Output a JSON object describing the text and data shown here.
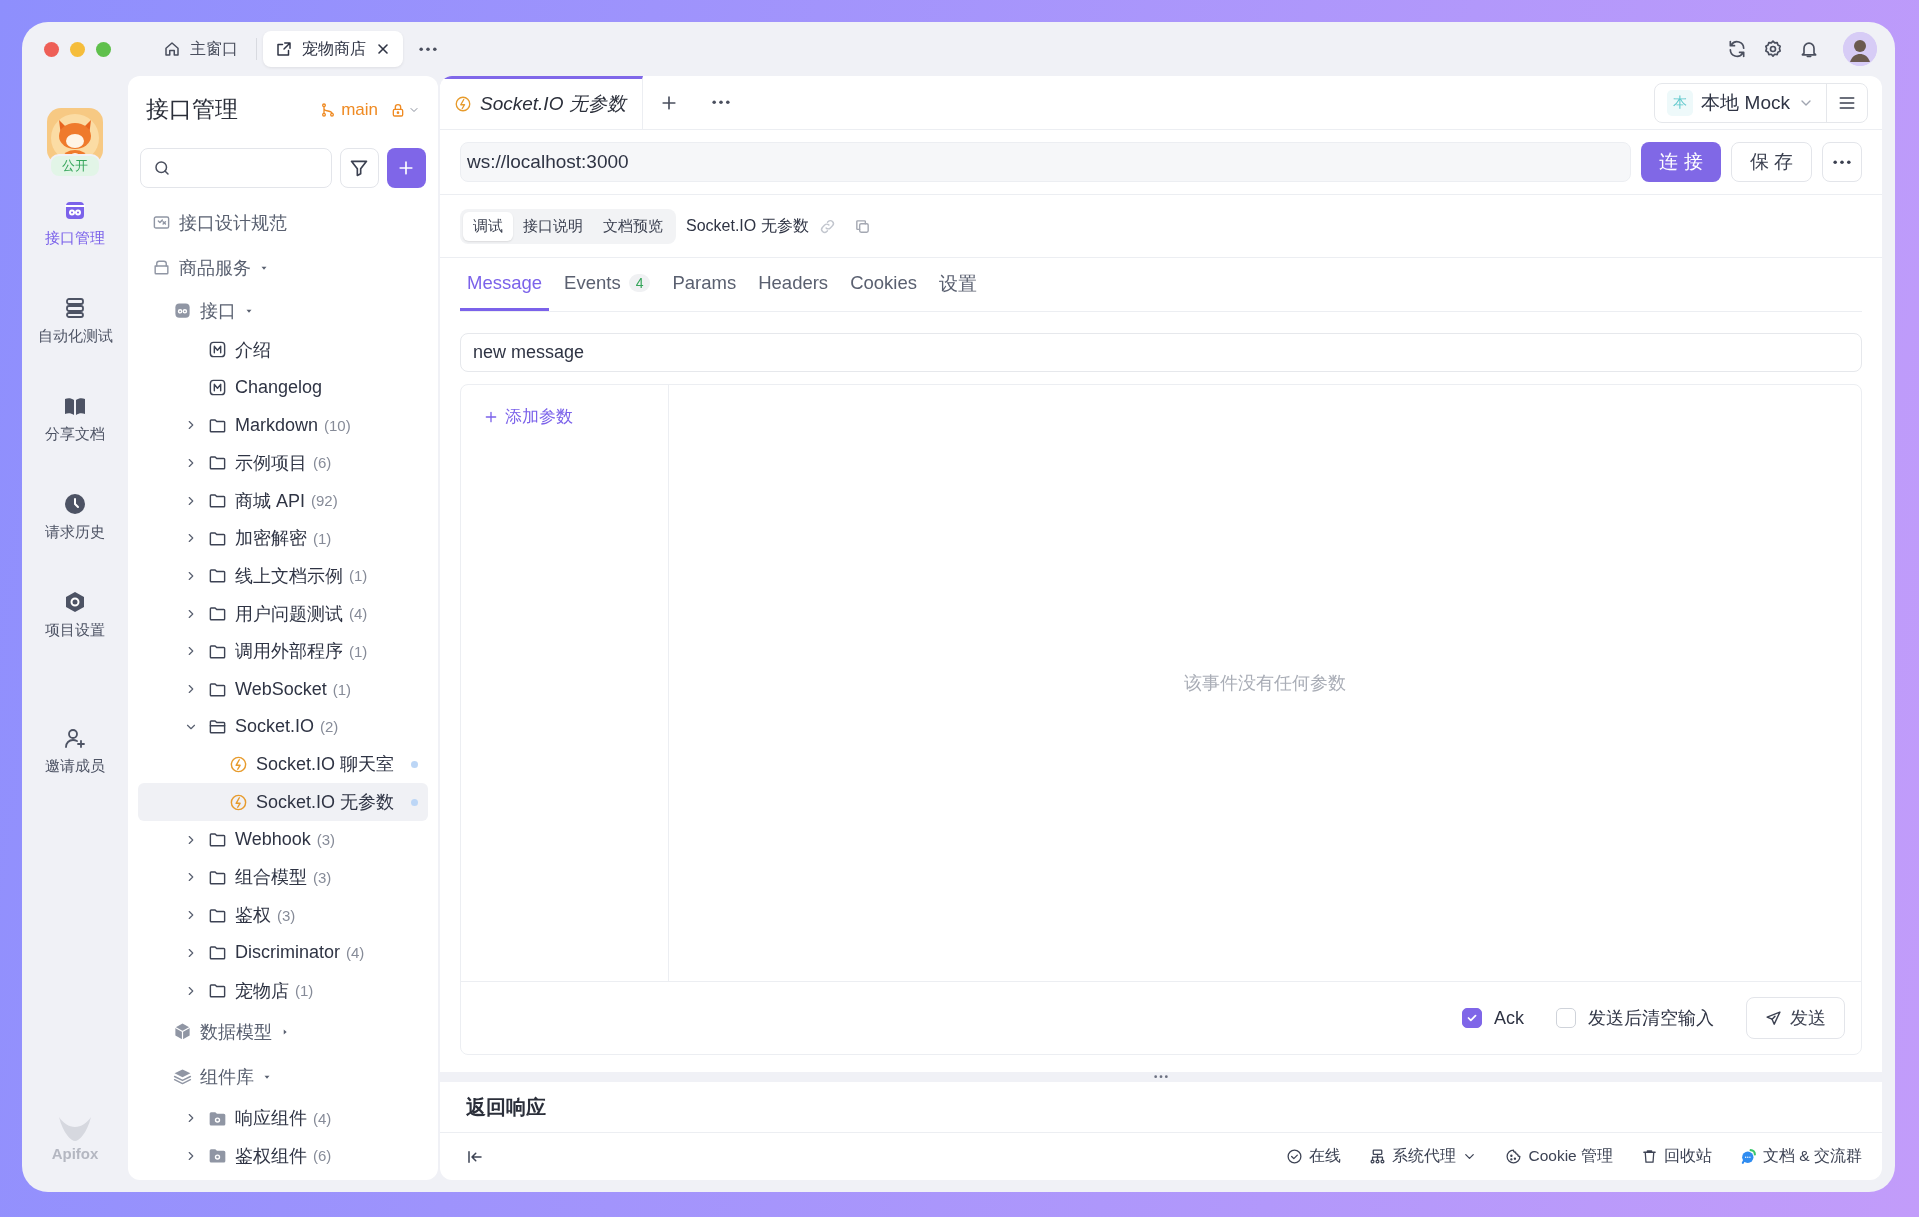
{
  "window": {
    "tabs": [
      {
        "kind": "home",
        "label": "主窗口",
        "selected": false,
        "closable": false
      },
      {
        "kind": "project",
        "label": "宠物商店",
        "selected": true,
        "closable": true
      }
    ]
  },
  "nav": {
    "project_badge": "公开",
    "items": [
      {
        "kind": "api",
        "label": "接口管理",
        "selected": true
      },
      {
        "kind": "test",
        "label": "自动化测试",
        "selected": false
      },
      {
        "kind": "docs",
        "label": "分享文档",
        "selected": false
      },
      {
        "kind": "history",
        "label": "请求历史",
        "selected": false
      },
      {
        "kind": "settings",
        "label": "项目设置",
        "selected": false
      },
      {
        "kind": "invite",
        "label": "邀请成员",
        "selected": false
      }
    ],
    "brand": "Apifox"
  },
  "sidebar": {
    "title": "接口管理",
    "branch": "main",
    "tree": [
      {
        "kind": "spec",
        "label": "接口设计规范",
        "selected": false
      },
      {
        "kind": "service",
        "label": "商品服务",
        "expanded": true,
        "selected": false,
        "children": [
          {
            "kind": "group",
            "label": "接口",
            "expanded": true,
            "selected": false,
            "children": [
              {
                "kind": "markdown",
                "label": "介绍",
                "selected": false
              },
              {
                "kind": "markdown",
                "label": "Changelog",
                "selected": false
              },
              {
                "kind": "folder",
                "label": "Markdown",
                "count": "(10)",
                "expanded": false,
                "selected": false
              },
              {
                "kind": "folder",
                "label": "示例项目",
                "count": "(6)",
                "expanded": false,
                "selected": false
              },
              {
                "kind": "folder",
                "label": "商城 API",
                "count": "(92)",
                "expanded": false,
                "selected": false
              },
              {
                "kind": "folder",
                "label": "加密解密",
                "count": "(1)",
                "expanded": false,
                "selected": false
              },
              {
                "kind": "folder",
                "label": "线上文档示例",
                "count": "(1)",
                "expanded": false,
                "selected": false
              },
              {
                "kind": "folder",
                "label": "用户问题测试",
                "count": "(4)",
                "expanded": false,
                "selected": false
              },
              {
                "kind": "folder",
                "label": "调用外部程序",
                "count": "(1)",
                "expanded": false,
                "selected": false
              },
              {
                "kind": "folder",
                "label": "WebSocket",
                "count": "(1)",
                "expanded": false,
                "selected": false
              },
              {
                "kind": "folder",
                "label": "Socket.IO",
                "count": "(2)",
                "expanded": true,
                "selected": false,
                "children": [
                  {
                    "kind": "socket",
                    "label": "Socket.IO 聊天室",
                    "selected": false
                  },
                  {
                    "kind": "socket",
                    "label": "Socket.IO 无参数",
                    "selected": true
                  }
                ]
              },
              {
                "kind": "folder",
                "label": "Webhook",
                "count": "(3)",
                "expanded": false,
                "selected": false
              },
              {
                "kind": "folder",
                "label": "组合模型",
                "count": "(3)",
                "expanded": false,
                "selected": false
              },
              {
                "kind": "folder",
                "label": "鉴权",
                "count": "(3)",
                "expanded": false,
                "selected": false
              },
              {
                "kind": "folder",
                "label": "Discriminator",
                "count": "(4)",
                "expanded": false,
                "selected": false
              },
              {
                "kind": "folder",
                "label": "宠物店",
                "count": "(1)",
                "expanded": false,
                "selected": false
              }
            ]
          },
          {
            "kind": "models",
            "label": "数据模型",
            "expanded": false,
            "selected": false
          },
          {
            "kind": "components",
            "label": "组件库",
            "expanded": true,
            "selected": false,
            "children": [
              {
                "kind": "component-folder",
                "label": "响应组件",
                "count": "(4)",
                "expanded": false,
                "selected": false
              },
              {
                "kind": "component-folder",
                "label": "鉴权组件",
                "count": "(6)",
                "expanded": false,
                "selected": false
              }
            ]
          }
        ]
      }
    ]
  },
  "editor": {
    "tab": {
      "label": "Socket.IO 无参数"
    },
    "environment": {
      "badge": "本",
      "label": "本地 Mock"
    },
    "url": "ws://localhost:3000",
    "actions": {
      "connect": "连 接",
      "save": "保 存"
    },
    "mode_tabs": [
      {
        "label": "调试",
        "selected": true
      },
      {
        "label": "接口说明",
        "selected": false
      },
      {
        "label": "文档预览",
        "selected": false
      }
    ],
    "endpoint_name": "Socket.IO 无参数",
    "tabs": [
      {
        "label": "Message",
        "selected": true
      },
      {
        "label": "Events",
        "count": "4",
        "selected": false
      },
      {
        "label": "Params",
        "selected": false
      },
      {
        "label": "Headers",
        "selected": false
      },
      {
        "label": "Cookies",
        "selected": false
      },
      {
        "label": "设置",
        "selected": false
      }
    ],
    "event_name": "new message",
    "add_param": "添加参数",
    "empty_text": "该事件没有任何参数",
    "ack": {
      "label": "Ack",
      "checked": true
    },
    "clear_after_send": {
      "label": "发送后清空输入",
      "checked": false
    },
    "send": "发送"
  },
  "response": {
    "title": "返回响应"
  },
  "status_bar": [
    {
      "kind": "online",
      "label": "在线",
      "dropdown": false
    },
    {
      "kind": "proxy",
      "label": "系统代理",
      "dropdown": true
    },
    {
      "kind": "cookie",
      "label": "Cookie 管理",
      "dropdown": false
    },
    {
      "kind": "trash",
      "label": "回收站",
      "dropdown": false
    },
    {
      "kind": "community",
      "label": "文档 & 交流群",
      "dropdown": false
    }
  ]
}
